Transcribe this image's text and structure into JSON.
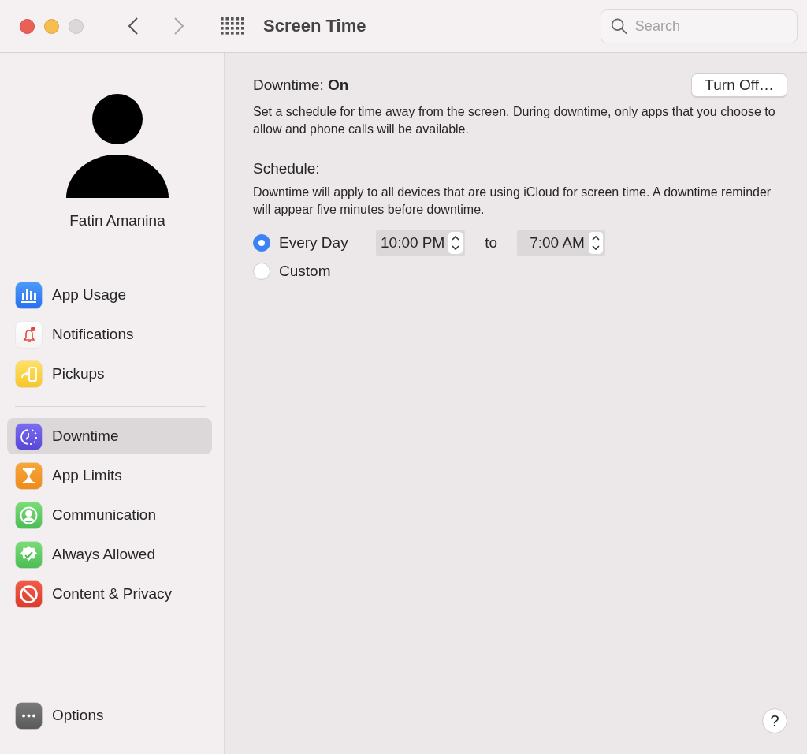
{
  "window": {
    "title": "Screen Time"
  },
  "search": {
    "placeholder": "Search"
  },
  "user": {
    "name": "Fatin Amanina"
  },
  "sidebar": {
    "groups": [
      {
        "items": [
          {
            "label": "App Usage",
            "kind": "usage",
            "selected": false
          },
          {
            "label": "Notifications",
            "kind": "notifications",
            "selected": false
          },
          {
            "label": "Pickups",
            "kind": "pickups",
            "selected": false
          }
        ]
      },
      {
        "items": [
          {
            "label": "Downtime",
            "kind": "downtime",
            "selected": true
          },
          {
            "label": "App Limits",
            "kind": "limits",
            "selected": false
          },
          {
            "label": "Communication",
            "kind": "communication",
            "selected": false
          },
          {
            "label": "Always Allowed",
            "kind": "allowed",
            "selected": false
          },
          {
            "label": "Content & Privacy",
            "kind": "privacy",
            "selected": false
          }
        ]
      }
    ],
    "footer": {
      "label": "Options",
      "kind": "options",
      "selected": false
    }
  },
  "content": {
    "status_label": "Downtime:",
    "status_value": "On",
    "button": "Turn Off…",
    "description": "Set a schedule for time away from the screen. During downtime, only apps that you choose to allow and phone calls will be available.",
    "schedule_title": "Schedule:",
    "schedule_note": "Downtime will apply to all devices that are using iCloud for screen time. A downtime reminder will appear five minutes before downtime.",
    "options": [
      {
        "label": "Every Day",
        "selected": true,
        "from": "10:00 PM",
        "separator": "to",
        "to": "7:00 AM"
      },
      {
        "label": "Custom",
        "selected": false
      }
    ]
  },
  "help": "?"
}
